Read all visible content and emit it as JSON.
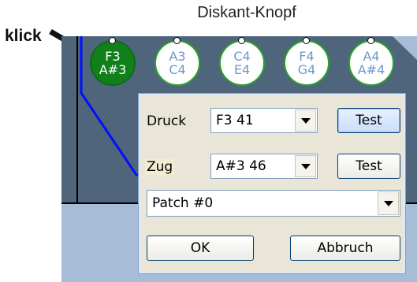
{
  "annotation": {
    "caption": "Diskant-Knopf",
    "click_label": "klick"
  },
  "note_buttons": [
    {
      "top": "F3",
      "bottom": "A#3",
      "active": true
    },
    {
      "top": "A3",
      "bottom": "C4",
      "active": false
    },
    {
      "top": "C4",
      "bottom": "E4",
      "active": false
    },
    {
      "top": "F4",
      "bottom": "G4",
      "active": false
    },
    {
      "top": "A4",
      "bottom": "A#4",
      "active": false
    }
  ],
  "dialog": {
    "druck_label": "Druck",
    "druck_value": "F3 41",
    "zug_label": "Zug",
    "zug_value": "A#3 46",
    "test_label": "Test",
    "patch_value": "Patch #0",
    "ok_label": "OK",
    "cancel_label": "Abbruch"
  },
  "colors": {
    "canvas_bg": "#a7bcd6",
    "dark_panel": "#4e657c",
    "curve": "#0010ff",
    "active_button": "#11801a",
    "inactive_border": "#2aa32a"
  }
}
